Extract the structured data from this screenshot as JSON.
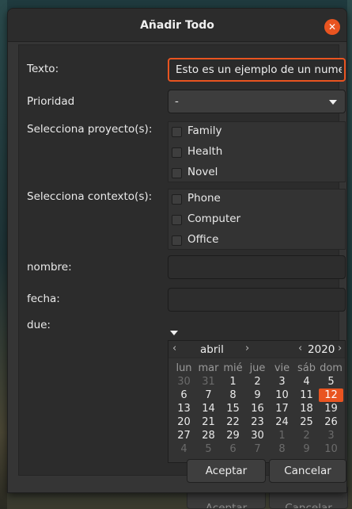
{
  "dialog": {
    "title": "Añadir Todo",
    "close_icon": "close-icon"
  },
  "form": {
    "texto_label": "Texto:",
    "texto_value": "Esto es un ejemplo de un numero",
    "prioridad_label": "Prioridad",
    "prioridad_value": "-",
    "proyecto_label": "Selecciona proyecto(s):",
    "projects": [
      "Family",
      "Health",
      "Novel"
    ],
    "contexto_label": "Selecciona contexto(s):",
    "contexts": [
      "Phone",
      "Computer",
      "Office"
    ],
    "nombre_label": "nombre:",
    "nombre_value": "",
    "fecha_label": "fecha:",
    "fecha_value": "",
    "due_label": "due:"
  },
  "calendar": {
    "month": "abril",
    "year": "2020",
    "weekdays": [
      "lun",
      "mar",
      "mié",
      "jue",
      "vie",
      "sáb",
      "dom"
    ],
    "weeks": [
      [
        [
          "30",
          true
        ],
        [
          "31",
          true
        ],
        [
          "1",
          false
        ],
        [
          "2",
          false
        ],
        [
          "3",
          false
        ],
        [
          "4",
          false
        ],
        [
          "5",
          false
        ]
      ],
      [
        [
          "6",
          false
        ],
        [
          "7",
          false
        ],
        [
          "8",
          false
        ],
        [
          "9",
          false
        ],
        [
          "10",
          false
        ],
        [
          "11",
          false
        ],
        [
          "12",
          false
        ]
      ],
      [
        [
          "13",
          false
        ],
        [
          "14",
          false
        ],
        [
          "15",
          false
        ],
        [
          "16",
          false
        ],
        [
          "17",
          false
        ],
        [
          "18",
          false
        ],
        [
          "19",
          false
        ]
      ],
      [
        [
          "20",
          false
        ],
        [
          "21",
          false
        ],
        [
          "22",
          false
        ],
        [
          "23",
          false
        ],
        [
          "24",
          false
        ],
        [
          "25",
          false
        ],
        [
          "26",
          false
        ]
      ],
      [
        [
          "27",
          false
        ],
        [
          "28",
          false
        ],
        [
          "29",
          false
        ],
        [
          "30",
          false
        ],
        [
          "1",
          true
        ],
        [
          "2",
          true
        ],
        [
          "3",
          true
        ]
      ],
      [
        [
          "4",
          true
        ],
        [
          "5",
          true
        ],
        [
          "6",
          true
        ],
        [
          "7",
          true
        ],
        [
          "8",
          true
        ],
        [
          "9",
          true
        ],
        [
          "10",
          true
        ]
      ]
    ],
    "selected_day": "12"
  },
  "buttons": {
    "accept": "Aceptar",
    "cancel": "Cancelar"
  },
  "colors": {
    "accent": "#e95420"
  }
}
